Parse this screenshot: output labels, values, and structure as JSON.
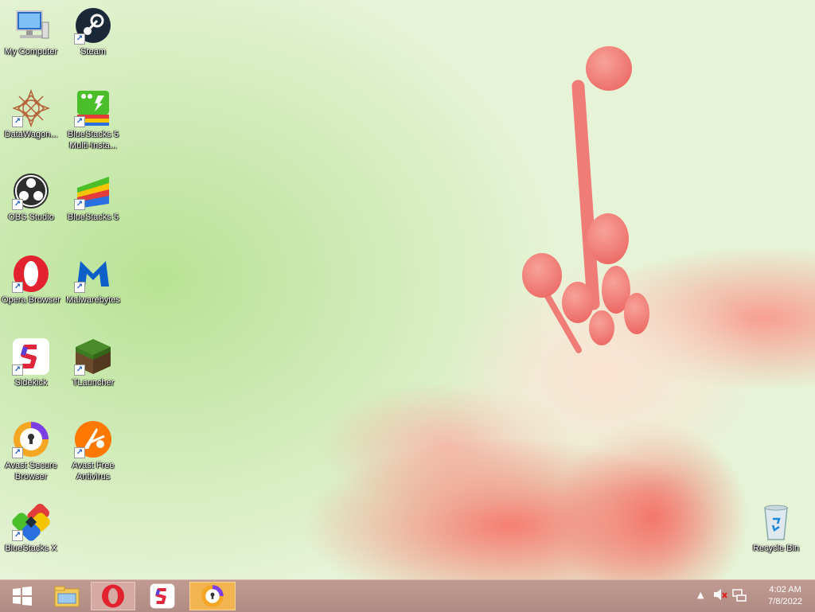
{
  "desktop_icons": [
    {
      "label": "My Computer",
      "icon": "computer-icon",
      "shortcut": false
    },
    {
      "label": "Steam",
      "icon": "steam-icon",
      "shortcut": true
    },
    {
      "label": "DataWagon...",
      "icon": "datawagon-icon",
      "shortcut": true
    },
    {
      "label": "BlueStacks 5 Multi-Insta...",
      "icon": "bluestacks-multi-instance-icon",
      "shortcut": true
    },
    {
      "label": "OBS Studio",
      "icon": "obs-icon",
      "shortcut": true
    },
    {
      "label": "BlueStacks 5",
      "icon": "bluestacks-icon",
      "shortcut": true
    },
    {
      "label": "Opera Browser",
      "icon": "opera-icon",
      "shortcut": true
    },
    {
      "label": "Malwarebytes",
      "icon": "malwarebytes-icon",
      "shortcut": true
    },
    {
      "label": "Sidekick",
      "icon": "sidekick-icon",
      "shortcut": true
    },
    {
      "label": "TLauncher",
      "icon": "tlauncher-icon",
      "shortcut": true
    },
    {
      "label": "Avast Secure Browser",
      "icon": "avast-secure-browser-icon",
      "shortcut": true
    },
    {
      "label": "Avast Free Antivirus",
      "icon": "avast-antivirus-icon",
      "shortcut": true
    },
    {
      "label": "BlueStacks X",
      "icon": "bluestacks-x-icon",
      "shortcut": true
    },
    {
      "label": "Recycle Bin",
      "icon": "recycle-bin-icon",
      "shortcut": false
    }
  ],
  "taskbar": {
    "items": [
      {
        "icon": "windows-start-icon"
      },
      {
        "icon": "file-explorer-icon"
      },
      {
        "icon": "opera-icon"
      },
      {
        "icon": "sidekick-icon"
      },
      {
        "icon": "avast-secure-browser-icon"
      }
    ],
    "tray": {
      "icons": [
        "show-hidden-icons-arrow-icon",
        "volume-muted-icon",
        "network-icon"
      ]
    },
    "clock": {
      "time": "4:02 AM",
      "date": "7/8/2022"
    }
  },
  "colors": {
    "taskbar": "#b8928a",
    "taskbar_active": "#f2b451",
    "wallpaper_green": "#c9e8a8",
    "flower": "#f07c78"
  }
}
